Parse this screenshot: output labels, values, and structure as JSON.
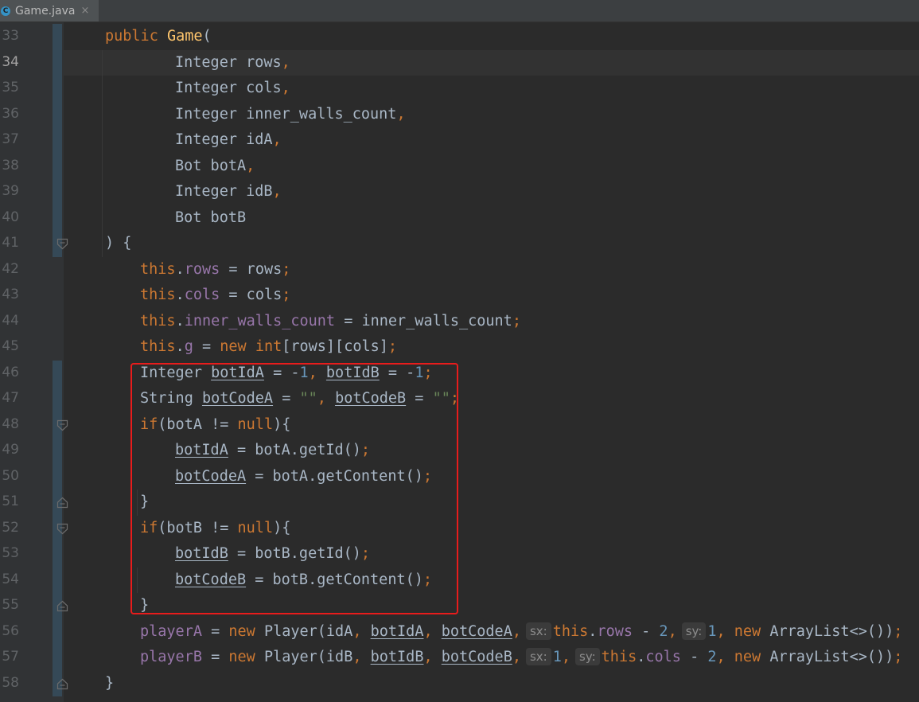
{
  "tab": {
    "filename": "Game.java",
    "icon_letter": "C",
    "close_glyph": "×"
  },
  "lines": [
    {
      "num": "33",
      "tokens": [
        [
          "kw",
          "public "
        ],
        [
          "fn",
          "Game"
        ],
        [
          "",
          "("
        ]
      ]
    },
    {
      "num": "34",
      "tokens": [
        [
          "",
          "Integer rows"
        ],
        [
          "kw",
          ","
        ]
      ]
    },
    {
      "num": "35",
      "tokens": [
        [
          "",
          "Integer cols"
        ],
        [
          "kw",
          ","
        ]
      ]
    },
    {
      "num": "36",
      "tokens": [
        [
          "",
          "Integer inner_walls_count"
        ],
        [
          "kw",
          ","
        ]
      ]
    },
    {
      "num": "37",
      "tokens": [
        [
          "",
          "Integer idA"
        ],
        [
          "kw",
          ","
        ]
      ]
    },
    {
      "num": "38",
      "tokens": [
        [
          "",
          "Bot botA"
        ],
        [
          "kw",
          ","
        ]
      ]
    },
    {
      "num": "39",
      "tokens": [
        [
          "",
          "Integer idB"
        ],
        [
          "kw",
          ","
        ]
      ]
    },
    {
      "num": "40",
      "tokens": [
        [
          "",
          "Bot botB"
        ]
      ]
    },
    {
      "num": "41",
      "tokens": [
        [
          "",
          ") {"
        ]
      ]
    },
    {
      "num": "42",
      "tokens": [
        [
          "kw",
          "this"
        ],
        [
          "",
          ".",
          ""
        ],
        [
          "fld",
          "rows"
        ],
        [
          "",
          " = rows"
        ],
        [
          "kw",
          ";"
        ]
      ]
    },
    {
      "num": "43",
      "tokens": [
        [
          "kw",
          "this"
        ],
        [
          "",
          "."
        ],
        [
          "fld",
          "cols"
        ],
        [
          "",
          " = cols"
        ],
        [
          "kw",
          ";"
        ]
      ]
    },
    {
      "num": "44",
      "tokens": [
        [
          "kw",
          "this"
        ],
        [
          "",
          "."
        ],
        [
          "fld",
          "inner_walls_count"
        ],
        [
          "",
          " = inner_walls_count"
        ],
        [
          "kw",
          ";"
        ]
      ]
    },
    {
      "num": "45",
      "tokens": [
        [
          "kw",
          "this"
        ],
        [
          "",
          "."
        ],
        [
          "fld",
          "g"
        ],
        [
          "",
          " = "
        ],
        [
          "kw",
          "new int"
        ],
        [
          "",
          "[rows][cols]"
        ],
        [
          "kw",
          ";"
        ]
      ]
    },
    {
      "num": "46",
      "tokens": [
        [
          "",
          "Integer "
        ],
        [
          "ul",
          "botIdA"
        ],
        [
          "",
          " = -"
        ],
        [
          "num",
          "1"
        ],
        [
          "kw",
          ", "
        ],
        [
          "ul",
          "botIdB"
        ],
        [
          "",
          " = -"
        ],
        [
          "num",
          "1"
        ],
        [
          "kw",
          ";"
        ]
      ]
    },
    {
      "num": "47",
      "tokens": [
        [
          "",
          "String "
        ],
        [
          "ul",
          "botCodeA"
        ],
        [
          "",
          " = "
        ],
        [
          "str",
          "\"\""
        ],
        [
          "kw",
          ", "
        ],
        [
          "ul",
          "botCodeB"
        ],
        [
          "",
          " = "
        ],
        [
          "str",
          "\"\""
        ],
        [
          "kw",
          ";"
        ]
      ]
    },
    {
      "num": "48",
      "tokens": [
        [
          "kw",
          "if"
        ],
        [
          "",
          "(botA != "
        ],
        [
          "kw",
          "null"
        ],
        [
          "",
          "){"
        ]
      ]
    },
    {
      "num": "49",
      "tokens": [
        [
          "ul",
          "botIdA"
        ],
        [
          "",
          " = botA.getId()"
        ],
        [
          "kw",
          ";"
        ]
      ]
    },
    {
      "num": "50",
      "tokens": [
        [
          "ul",
          "botCodeA"
        ],
        [
          "",
          " = botA.getContent()"
        ],
        [
          "kw",
          ";"
        ]
      ]
    },
    {
      "num": "51",
      "tokens": [
        [
          "",
          "}"
        ]
      ]
    },
    {
      "num": "52",
      "tokens": [
        [
          "kw",
          "if"
        ],
        [
          "",
          "(botB != "
        ],
        [
          "kw",
          "null"
        ],
        [
          "",
          "){"
        ]
      ]
    },
    {
      "num": "53",
      "tokens": [
        [
          "ul",
          "botIdB"
        ],
        [
          "",
          " = botB.getId()"
        ],
        [
          "kw",
          ";"
        ]
      ]
    },
    {
      "num": "54",
      "tokens": [
        [
          "ul",
          "botCodeB"
        ],
        [
          "",
          " = botB.getContent()"
        ],
        [
          "kw",
          ";"
        ]
      ]
    },
    {
      "num": "55",
      "tokens": [
        [
          "",
          "}"
        ]
      ]
    },
    {
      "num": "56",
      "tokens": [
        [
          "fld",
          "playerA"
        ],
        [
          "",
          " = "
        ],
        [
          "kw",
          "new "
        ],
        [
          "",
          "Player(idA"
        ],
        [
          "kw",
          ", "
        ],
        [
          "ul",
          "botIdA"
        ],
        [
          "kw",
          ", "
        ],
        [
          "ul",
          "botCodeA"
        ],
        [
          "kw",
          ","
        ],
        [
          "hint",
          "sx:"
        ],
        [
          "kw",
          "this"
        ],
        [
          "",
          "."
        ],
        [
          "fld",
          "rows"
        ],
        [
          "",
          " - "
        ],
        [
          "num",
          "2"
        ],
        [
          "kw",
          ","
        ],
        [
          "hint",
          "sy:"
        ],
        [
          "num",
          "1"
        ],
        [
          "kw",
          ", new "
        ],
        [
          "",
          "ArrayList<>())"
        ],
        [
          "kw",
          ";"
        ]
      ]
    },
    {
      "num": "57",
      "tokens": [
        [
          "fld",
          "playerB"
        ],
        [
          "",
          " = "
        ],
        [
          "kw",
          "new "
        ],
        [
          "",
          "Player(idB"
        ],
        [
          "kw",
          ", "
        ],
        [
          "ul",
          "botIdB"
        ],
        [
          "kw",
          ", "
        ],
        [
          "ul",
          "botCodeB"
        ],
        [
          "kw",
          ","
        ],
        [
          "hint",
          "sx:"
        ],
        [
          "num",
          "1"
        ],
        [
          "kw",
          ","
        ],
        [
          "hint",
          "sy:"
        ],
        [
          "kw",
          "this"
        ],
        [
          "",
          "."
        ],
        [
          "fld",
          "cols"
        ],
        [
          "",
          " - "
        ],
        [
          "num",
          "2"
        ],
        [
          "kw",
          ", new "
        ],
        [
          "",
          "ArrayList<>())"
        ],
        [
          "kw",
          ";"
        ]
      ]
    },
    {
      "num": "58",
      "tokens": [
        [
          "",
          "}"
        ]
      ]
    }
  ],
  "colors": {
    "background": "#2b2b2b",
    "keyword": "#cc7832",
    "method_decl": "#ffc66d",
    "number": "#6897bb",
    "string": "#6a8759",
    "field": "#9876aa",
    "plain": "#a9b7c6",
    "highlight_box": "#e81c1c"
  }
}
